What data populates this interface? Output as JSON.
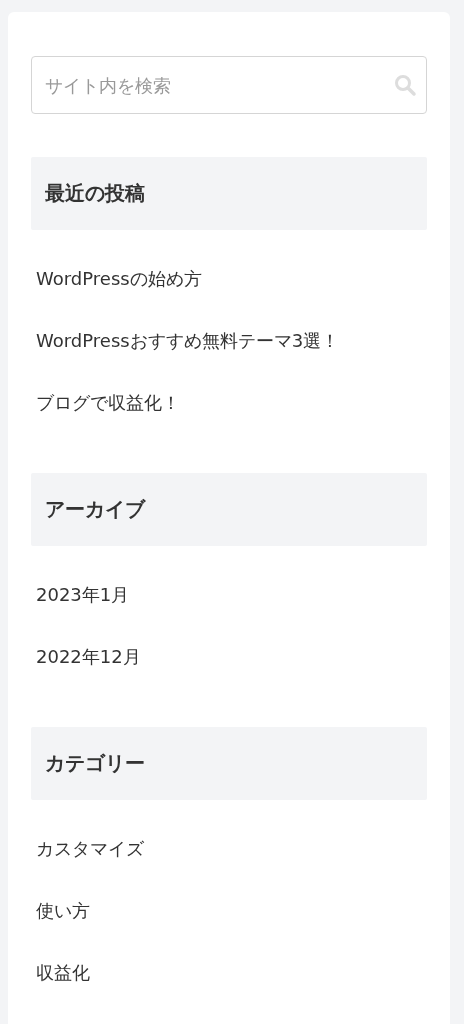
{
  "search": {
    "placeholder": "サイト内を検索"
  },
  "widgets": [
    {
      "title": "最近の投稿",
      "items": [
        "WordPressの始め方",
        "WordPressおすすめ無料テーマ3選！",
        "ブログで収益化！"
      ]
    },
    {
      "title": "アーカイブ",
      "items": [
        "2023年1月",
        "2022年12月"
      ]
    },
    {
      "title": "カテゴリー",
      "items": [
        "カスタマイズ",
        "使い方",
        "収益化"
      ]
    }
  ]
}
